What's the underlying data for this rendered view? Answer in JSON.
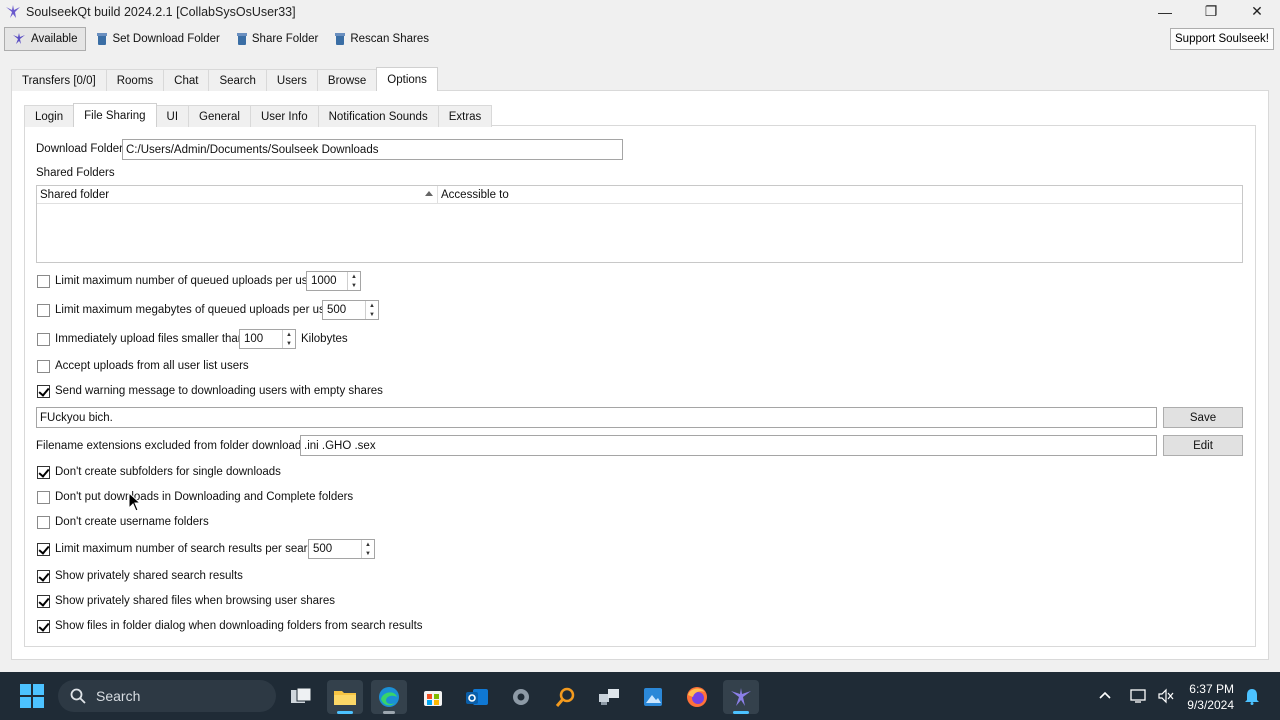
{
  "window": {
    "title": "SoulseekQt build 2024.2.1 [CollabSysOsUser33]",
    "minimize": "—",
    "maximize": "❐",
    "close": "✕"
  },
  "toolbar": {
    "available": "Available",
    "set_download_folder": "Set Download Folder",
    "share_folder": "Share Folder",
    "rescan_shares": "Rescan Shares",
    "support": "Support Soulseek!"
  },
  "main_tabs": [
    "Transfers [0/0]",
    "Rooms",
    "Chat",
    "Search",
    "Users",
    "Browse",
    "Options"
  ],
  "sub_tabs": [
    "Login",
    "File Sharing",
    "UI",
    "General",
    "User Info",
    "Notification Sounds",
    "Extras"
  ],
  "file_sharing": {
    "download_folder_label": "Download Folder",
    "download_folder_value": "C:/Users/Admin/Documents/Soulseek Downloads",
    "shared_folders_label": "Shared Folders",
    "table_headers": [
      "Shared folder",
      "Accessible to"
    ],
    "limit_queued_uploads_label": "Limit maximum number of queued uploads per user",
    "limit_queued_uploads_value": "1000",
    "limit_queued_mb_label": "Limit maximum megabytes of queued uploads per user",
    "limit_queued_mb_value": "500",
    "immediate_upload_label": "Immediately upload files smaller than",
    "immediate_upload_value": "100",
    "kilobytes_label": "Kilobytes",
    "accept_uploads_label": "Accept uploads from all user list users",
    "send_warning_label": "Send warning message to downloading users with empty shares",
    "warning_message_value": "FUckyou bich.",
    "save_label": "Save",
    "excluded_ext_label": "Filename extensions excluded from folder downloads:",
    "excluded_ext_value": ".ini .GHO .sex",
    "edit_label": "Edit",
    "no_subfolders_label": "Don't create subfolders for single downloads",
    "no_downloading_folders_label": "Don't put downloads in Downloading and Complete folders",
    "no_username_folders_label": "Don't create username folders",
    "limit_search_results_label": "Limit maximum number of search results per search",
    "limit_search_results_value": "500",
    "show_private_search_label": "Show privately shared search results",
    "show_private_browse_label": "Show privately shared files when browsing user shares",
    "show_folder_dialog_label": "Show files in folder dialog when downloading folders from search results"
  },
  "checkbox_states": {
    "limit_queued_uploads": false,
    "limit_queued_mb": false,
    "immediate_upload": false,
    "accept_uploads": false,
    "send_warning": true,
    "no_subfolders": true,
    "no_downloading_folders": false,
    "no_username_folders": false,
    "limit_search_results": true,
    "show_private_search": true,
    "show_private_browse": true,
    "show_folder_dialog": true
  },
  "taskbar": {
    "search_label": "Search",
    "time": "6:37 PM",
    "date": "9/3/2024"
  },
  "colors": {
    "taskbar_bg": "#1f2b36",
    "accent": "#4cc2ff"
  }
}
